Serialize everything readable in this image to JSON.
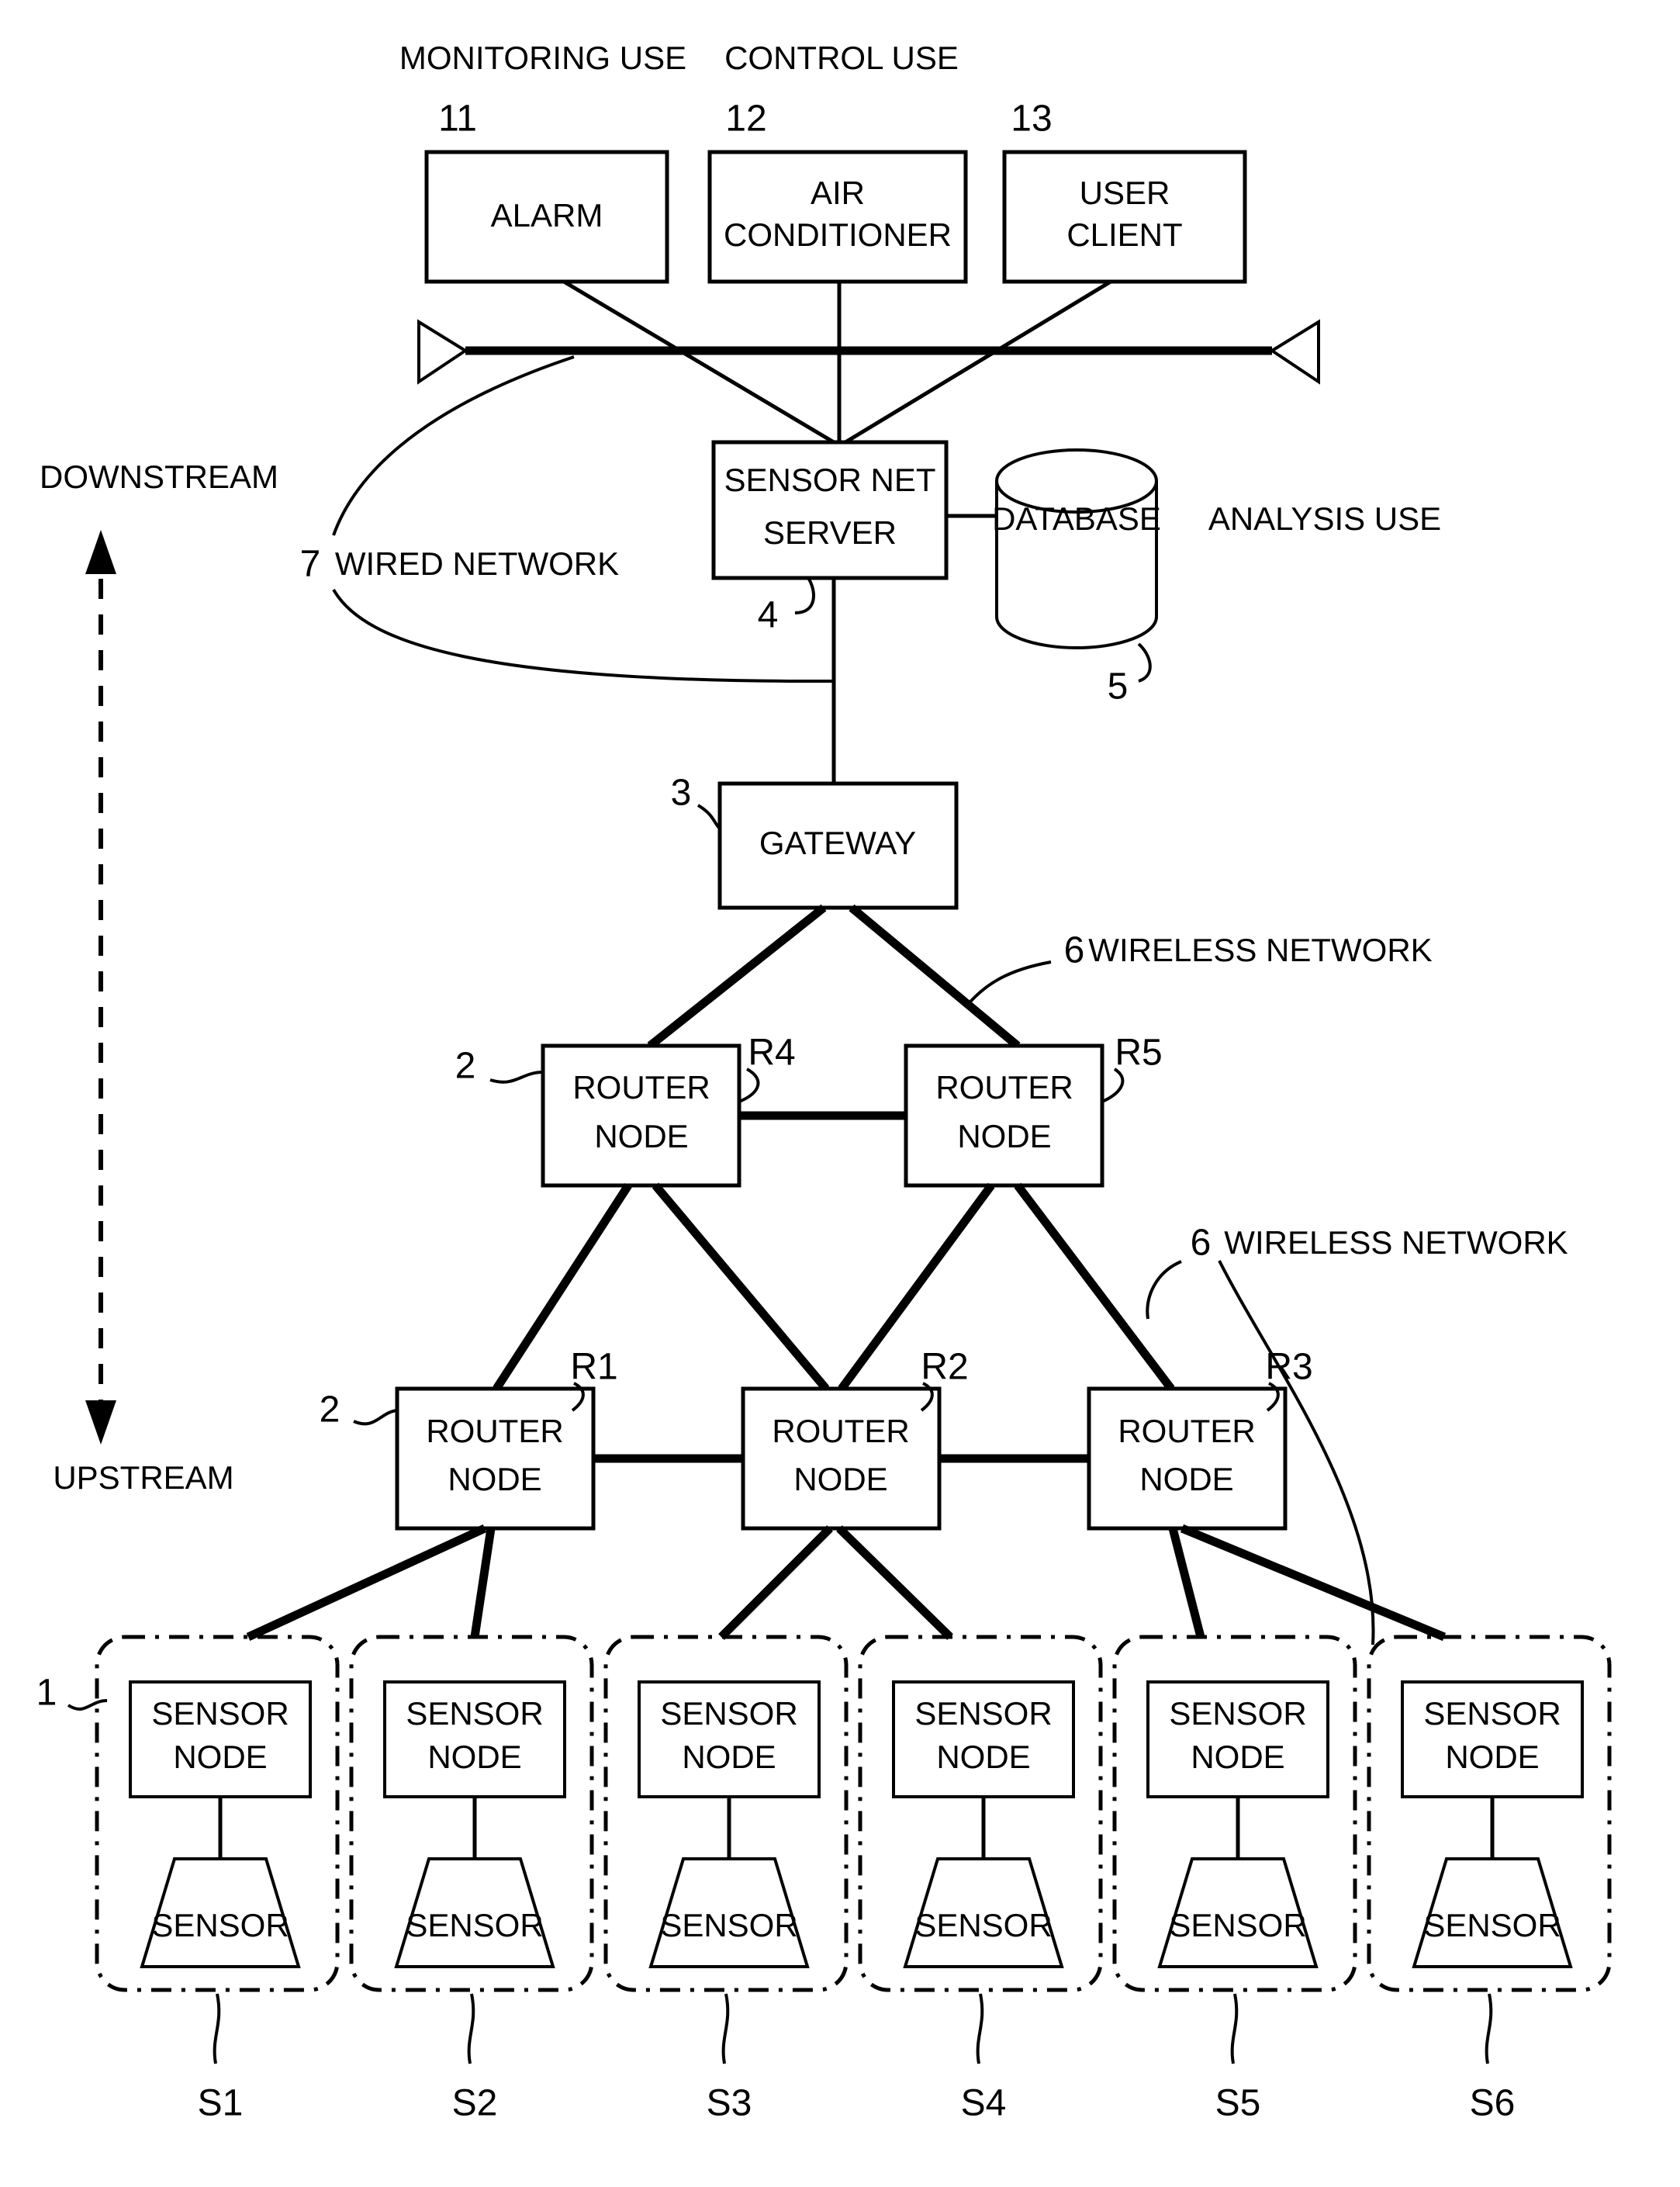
{
  "figure": {
    "title": "Sensor network system configuration diagram",
    "background_color": "#ffffff",
    "line_color": "#000000"
  },
  "captions": {
    "monitoring_use": "MONITORING USE",
    "control_use": "CONTROL USE",
    "analysis_use": "ANALYSIS USE",
    "downstream": "DOWNSTREAM",
    "upstream": "UPSTREAM",
    "wired_network": "WIRED NETWORK",
    "wireless_network_upper": "WIRELESS NETWORK",
    "wireless_network_lower": "WIRELESS NETWORK"
  },
  "reference_numerals": {
    "alarm": "11",
    "air_conditioner": "12",
    "user_client": "13",
    "sensor_net_server": "4",
    "database": "5",
    "gateway": "3",
    "wired_network": "7",
    "wireless_network_upper": "6",
    "wireless_network_lower": "6",
    "router_node_upper_group": "2",
    "router_node_lower_group": "2",
    "sensor_node_group": "1"
  },
  "top_devices": [
    {
      "id": "alarm",
      "label_line1": "ALARM",
      "label_line2": "",
      "ref": "11",
      "caption": "MONITORING USE"
    },
    {
      "id": "air-conditioner",
      "label_line1": "AIR",
      "label_line2": "CONDITIONER",
      "ref": "12",
      "caption": "CONTROL USE"
    },
    {
      "id": "user-client",
      "label_line1": "USER",
      "label_line2": "CLIENT",
      "ref": "13",
      "caption": ""
    }
  ],
  "server": {
    "label_line1": "SENSOR NET",
    "label_line2": "SERVER",
    "ref": "4"
  },
  "database": {
    "label": "DATABASE",
    "ref": "5",
    "caption": "ANALYSIS USE"
  },
  "gateway": {
    "label": "GATEWAY",
    "ref": "3"
  },
  "router_nodes_upper": [
    {
      "id": "R4",
      "label_line1": "ROUTER",
      "label_line2": "NODE",
      "tag": "R4"
    },
    {
      "id": "R5",
      "label_line1": "ROUTER",
      "label_line2": "NODE",
      "tag": "R5"
    }
  ],
  "router_nodes_lower": [
    {
      "id": "R1",
      "label_line1": "ROUTER",
      "label_line2": "NODE",
      "tag": "R1"
    },
    {
      "id": "R2",
      "label_line1": "ROUTER",
      "label_line2": "NODE",
      "tag": "R2"
    },
    {
      "id": "R3",
      "label_line1": "ROUTER",
      "label_line2": "NODE",
      "tag": "R3"
    }
  ],
  "sensor_groups": [
    {
      "id": "S1",
      "tag": "S1",
      "node_line1": "SENSOR",
      "node_line2": "NODE",
      "sensor_label": "SENSOR"
    },
    {
      "id": "S2",
      "tag": "S2",
      "node_line1": "SENSOR",
      "node_line2": "NODE",
      "sensor_label": "SENSOR"
    },
    {
      "id": "S3",
      "tag": "S3",
      "node_line1": "SENSOR",
      "node_line2": "NODE",
      "sensor_label": "SENSOR"
    },
    {
      "id": "S4",
      "tag": "S4",
      "node_line1": "SENSOR",
      "node_line2": "NODE",
      "sensor_label": "SENSOR"
    },
    {
      "id": "S5",
      "tag": "S5",
      "node_line1": "SENSOR",
      "node_line2": "NODE",
      "sensor_label": "SENSOR"
    },
    {
      "id": "S6",
      "tag": "S6",
      "node_line1": "SENSOR",
      "node_line2": "NODE",
      "sensor_label": "SENSOR"
    }
  ]
}
